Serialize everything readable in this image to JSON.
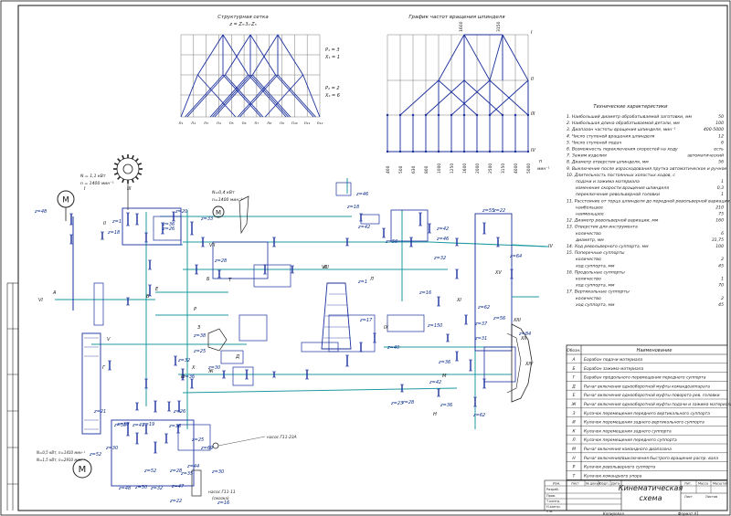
{
  "structure_chart": {
    "title": "Структурная сетка",
    "formula": "z = Z₃·3₁·Z₃",
    "p1": "P₁ = 3",
    "x1": "X₁ = 1",
    "p2": "P₂ = 2",
    "x2": "X₂ = 6",
    "n_labels": [
      "n₁",
      "n₂",
      "n₃",
      "n₄",
      "n₅",
      "n₆",
      "n₇",
      "n₈",
      "n₉",
      "n₁₀",
      "n₁₁",
      "n₁₂"
    ]
  },
  "speed_chart": {
    "title": "График частот вращения шпинделя",
    "top_values": [
      "1600",
      "3150"
    ],
    "shaft_labels": [
      "I",
      "II",
      "III",
      "IV"
    ],
    "axis_unit": "мин⁻¹",
    "axis_var": "n",
    "axis_values": [
      "400",
      "500",
      "630",
      "800",
      "1000",
      "1250",
      "1600",
      "2000",
      "2500",
      "3150",
      "4000",
      "5000"
    ]
  },
  "tech": {
    "title": "Технические характеристики",
    "items": [
      {
        "label": "1. Наибольший диаметр обрабатываемой заготовки, мм",
        "value": "50"
      },
      {
        "label": "2. Наибольшая длина обрабатываемой детали, мм",
        "value": "100"
      },
      {
        "label": "3. Диапазон частоты вращения шпинделя, мин⁻¹",
        "value": "400-5000"
      },
      {
        "label": "4. Число ступеней вращения шпинделя",
        "value": "12"
      },
      {
        "label": "5. Число ступеней подач",
        "value": "6"
      },
      {
        "label": "6. Возможность переключения скоростей на ходу",
        "value": "есть"
      },
      {
        "label": "7. Зажим изделия",
        "value": "автоматический"
      },
      {
        "label": "8. Диаметр отверстия шпинделя, мм",
        "value": "56"
      },
      {
        "label": "9. Выключение после израсходования прутка автоматическое и ручное",
        "value": ""
      },
      {
        "label": "10. Длительность постоянных холостых ходов, с",
        "value": ""
      },
      {
        "label": "подачи и зажима материала",
        "value": "1"
      },
      {
        "label": "изменение скорости вращения шпинделя",
        "value": "0,3"
      },
      {
        "label": "переключение револьверной головки",
        "value": "1"
      },
      {
        "label": "11. Расстояние от торца шпинделя до передней револьверной вариации, мм",
        "value": ""
      },
      {
        "label": "наибольшее",
        "value": "210"
      },
      {
        "label": "наименьшее",
        "value": "75"
      },
      {
        "label": "12. Диаметр револьверной вариации, мм",
        "value": "160"
      },
      {
        "label": "13. Отверстия для инструмента",
        "value": ""
      },
      {
        "label": "количество",
        "value": "6"
      },
      {
        "label": "диаметр, мм",
        "value": "31,75"
      },
      {
        "label": "14. Ход револьверного суппорта, мм",
        "value": "100"
      },
      {
        "label": "15. Поперечные суппорты",
        "value": ""
      },
      {
        "label": "количество",
        "value": "2"
      },
      {
        "label": "ход суппорта, мм",
        "value": "45"
      },
      {
        "label": "16. Продольные суппорты",
        "value": ""
      },
      {
        "label": "количество",
        "value": "1"
      },
      {
        "label": "ход суппорта, мм",
        "value": "70"
      },
      {
        "label": "17. Вертикальные суппорты",
        "value": ""
      },
      {
        "label": "количество",
        "value": "2"
      },
      {
        "label": "ход суппорта, мм",
        "value": "45"
      }
    ]
  },
  "legend": {
    "col1": "Обозн.",
    "col2": "Наименование",
    "rows": [
      {
        "code": "А",
        "name": "Барабан подачи материала"
      },
      {
        "code": "Б",
        "name": "Барабан зажима материала"
      },
      {
        "code": "Г",
        "name": "Барабан продольного перемещения переднего суппорта"
      },
      {
        "code": "Д",
        "name": "Рычаг включения однооборотной муфты командоаппарата"
      },
      {
        "code": "Е",
        "name": "Рычаг включения однооборотной муфты поворота рев. головки"
      },
      {
        "code": "Ж",
        "name": "Рычаг включения однооборотной муфты подачи и зажима материала"
      },
      {
        "code": "З",
        "name": "Кулачок перемещения переднего вертикального суппорта"
      },
      {
        "code": "И",
        "name": "Кулачок перемещения заднего вертикального суппорта"
      },
      {
        "code": "К",
        "name": "Кулачок перемещения заднего суппорта"
      },
      {
        "code": "Л",
        "name": "Кулачок перемещения переднего суппорта"
      },
      {
        "code": "М",
        "name": "Рычаг включения командного диапазона"
      },
      {
        "code": "Н",
        "name": "Рычаг включения/выключения быстрого вращения распр. вала"
      },
      {
        "code": "Р",
        "name": "Кулачок револьверного суппорта"
      },
      {
        "code": "Т",
        "name": "Кулачок командного упора"
      }
    ]
  },
  "title_block": {
    "title_line1": "Кинематическая",
    "title_line2": "схема",
    "lit": "Лит.",
    "mass": "Масса",
    "scale": "Масштаб",
    "sheet": "Лист",
    "sheets": "Листов",
    "copied": "Копировал",
    "format": "Формат A1",
    "rows": [
      "Изм.",
      "Лист",
      "№ докум.",
      "Подп.",
      "Дата",
      "Разраб.",
      "Пров.",
      "Т.контр.",
      "Н.контр.",
      "Утв."
    ]
  },
  "motors": {
    "m1_power": "N = 1,1 кВт",
    "m1_speed": "n = 1400 мин⁻¹",
    "m2_power": "N=0,4 кВт",
    "m2_speed": "n=1400 мин⁻¹",
    "m3_power1": "N=0,5 кВт, n=1410 мин⁻¹",
    "m3_power2": "N=1,5 кВт, n=2910 мин⁻¹",
    "m_symbol": "M"
  },
  "pumps": {
    "pump1": "насос Г11-23А",
    "pump2": "насос Г11-11",
    "pump2_sub": "(смазка)"
  },
  "gear_labels": [
    "z=48",
    "z=20",
    "z=30",
    "z=36",
    "z=26",
    "z=33",
    "z=26",
    "z=18",
    "z=1",
    "z=25",
    "z=38",
    "z=40",
    "z=42",
    "z=55",
    "z=22",
    "z=64",
    "z=50",
    "z=46",
    "z=32",
    "z=17",
    "z=62",
    "z=37",
    "z=56",
    "z=31",
    "z=84",
    "z=28",
    "z=52",
    "z=35",
    "z=41",
    "z=36",
    "z=30",
    "z=32",
    "z=21",
    "z=30",
    "z=48",
    "z=47",
    "z=32",
    "z=30",
    "z=19",
    "z=36",
    "z=25",
    "z=69",
    "z=44",
    "z=35",
    "z=52",
    "z=28",
    "z=30",
    "z=22",
    "z=16",
    "z=36",
    "z=42",
    "z=36",
    "z=28",
    "z=23",
    "z=16",
    "z=150",
    "z=46",
    "z=42",
    "z=18",
    "z=1",
    "z=62"
  ],
  "shaft_roman": [
    "I",
    "II",
    "III",
    "IV",
    "V",
    "VI",
    "VII",
    "VIII",
    "IX",
    "X",
    "XI",
    "XII",
    "XIII",
    "XIV",
    "XV"
  ],
  "misc_labels": [
    "A",
    "Б",
    "В",
    "Г",
    "Д",
    "Е",
    "Ж",
    "З",
    "И",
    "К",
    "Л",
    "М",
    "Н",
    "Р",
    "Т"
  ]
}
